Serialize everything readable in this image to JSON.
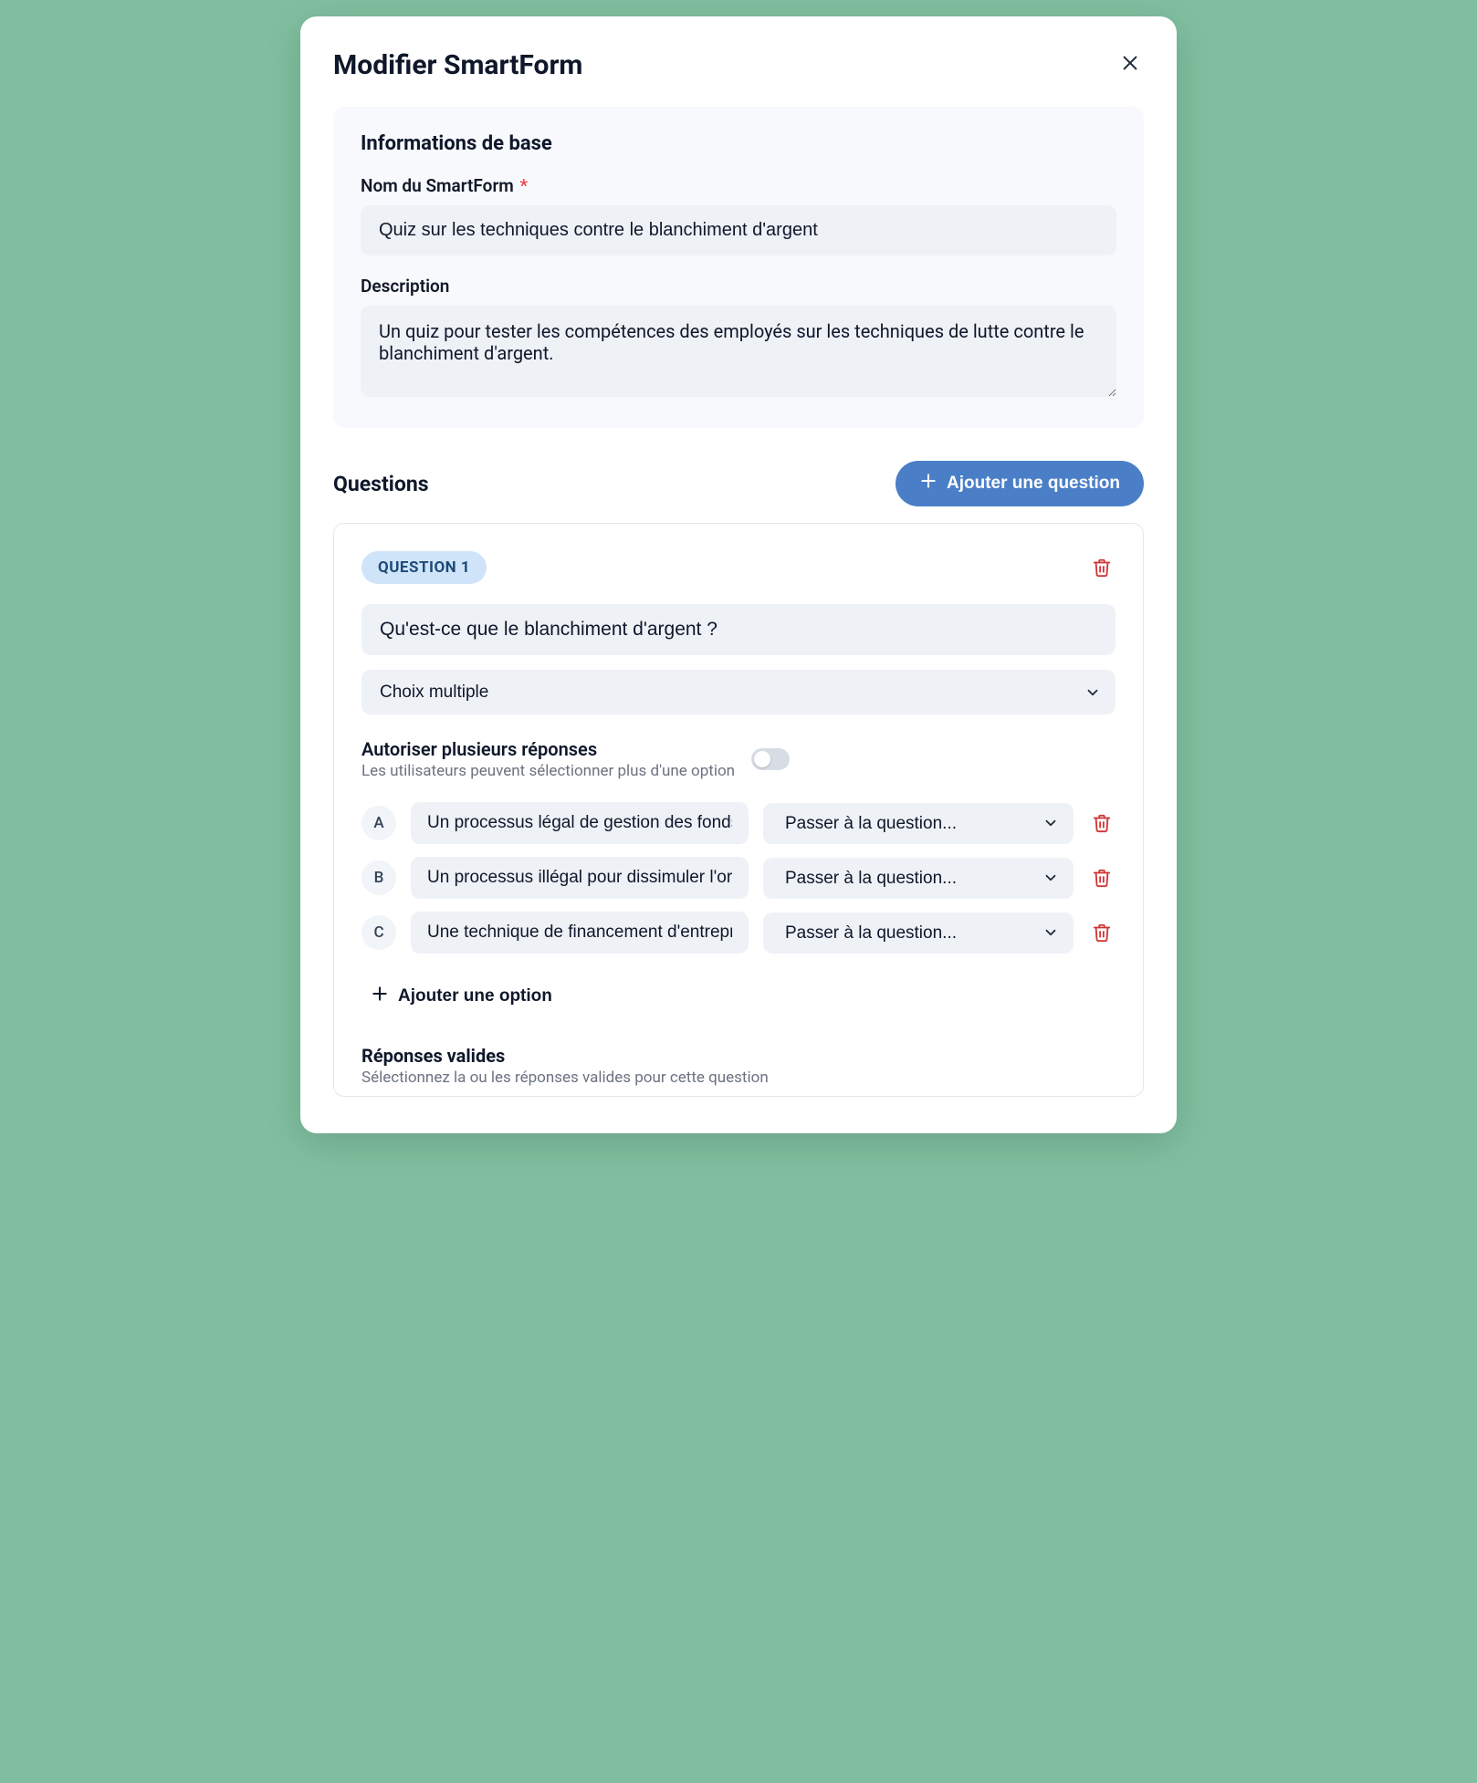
{
  "modal": {
    "title": "Modifier SmartForm"
  },
  "basic_info": {
    "heading": "Informations de base",
    "name_label": "Nom du SmartForm",
    "name_value": "Quiz sur les techniques contre le blanchiment d'argent",
    "description_label": "Description",
    "description_value": "Un quiz pour tester les compétences des employés sur les techniques de lutte contre le blanchiment d'argent."
  },
  "questions_section": {
    "title": "Questions",
    "add_button": "Ajouter une question"
  },
  "question1": {
    "badge": "QUESTION 1",
    "text": "Qu'est-ce que le blanchiment d'argent ?",
    "type": "Choix multiple",
    "allow_multiple_title": "Autoriser plusieurs réponses",
    "allow_multiple_sub": "Les utilisateurs peuvent sélectionner plus d'une option",
    "options": [
      {
        "letter": "A",
        "text": "Un processus légal de gestion des fonds",
        "skip": "Passer à la question..."
      },
      {
        "letter": "B",
        "text": "Un processus illégal pour dissimuler l'origine des fonds",
        "skip": "Passer à la question..."
      },
      {
        "letter": "C",
        "text": "Une technique de financement d'entreprise",
        "skip": "Passer à la question..."
      }
    ],
    "add_option": "Ajouter une option",
    "valid_answers_title": "Réponses valides",
    "valid_answers_sub": "Sélectionnez la ou les réponses valides pour cette question"
  }
}
